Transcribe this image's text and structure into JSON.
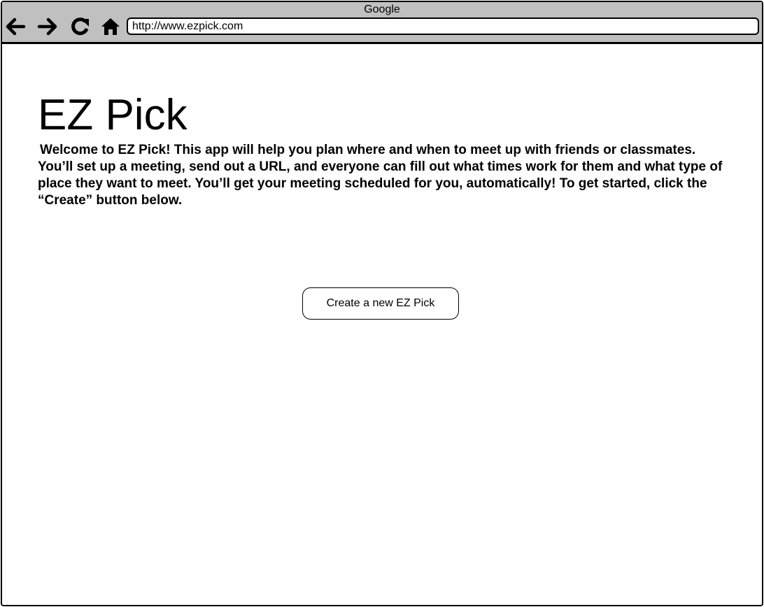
{
  "browser": {
    "title": "Google",
    "url": "http://www.ezpick.com",
    "nav_icons": [
      "back-arrow-icon",
      "forward-arrow-icon",
      "reload-icon",
      "home-icon"
    ]
  },
  "page": {
    "title": "EZ Pick",
    "intro": "Welcome to EZ Pick! This app will help you plan where and when to meet up with friends or classmates. You’ll set up a meeting, send out a URL, and everyone can fill out what times work for them and what type of place they want to meet. You’ll get your meeting scheduled for you, automatically! To get started, click the “Create” button below.",
    "create_button_label": "Create a new EZ Pick"
  }
}
